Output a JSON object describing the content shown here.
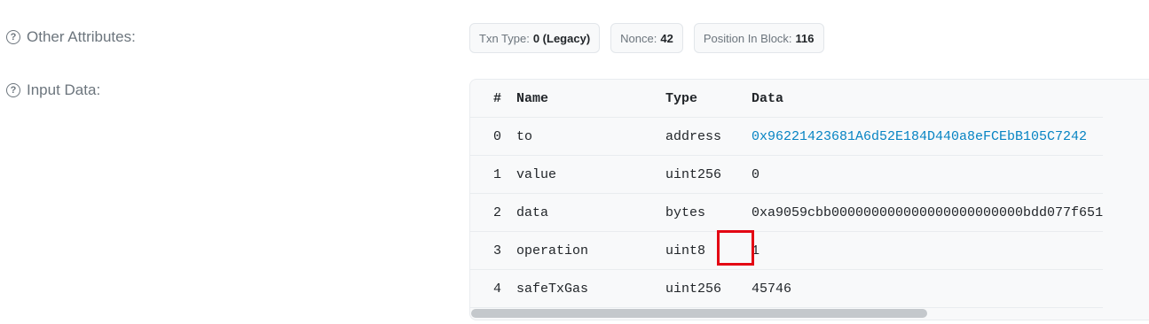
{
  "other_attributes": {
    "label": "Other Attributes:",
    "badges": [
      {
        "key": "Txn Type:",
        "value": "0 (Legacy)"
      },
      {
        "key": "Nonce:",
        "value": "42"
      },
      {
        "key": "Position In Block:",
        "value": "116"
      }
    ]
  },
  "input_data": {
    "label": "Input Data:",
    "headers": {
      "index": "#",
      "name": "Name",
      "type": "Type",
      "data": "Data"
    },
    "rows": [
      {
        "index": "0",
        "name": "to",
        "type": "address",
        "data": "0x96221423681A6d52E184D440a8eFCEbB105C7242"
      },
      {
        "index": "1",
        "name": "value",
        "type": "uint256",
        "data": "0"
      },
      {
        "index": "2",
        "name": "data",
        "type": "bytes",
        "data": "0xa9059cbb000000000000000000000000bdd077f651"
      },
      {
        "index": "3",
        "name": "operation",
        "type": "uint8",
        "data": "1"
      },
      {
        "index": "4",
        "name": "safeTxGas",
        "type": "uint256",
        "data": "45746"
      }
    ]
  },
  "icons": {
    "help": "question-circle-icon"
  },
  "colors": {
    "link": "#0784c3",
    "highlight": "#e30613"
  }
}
